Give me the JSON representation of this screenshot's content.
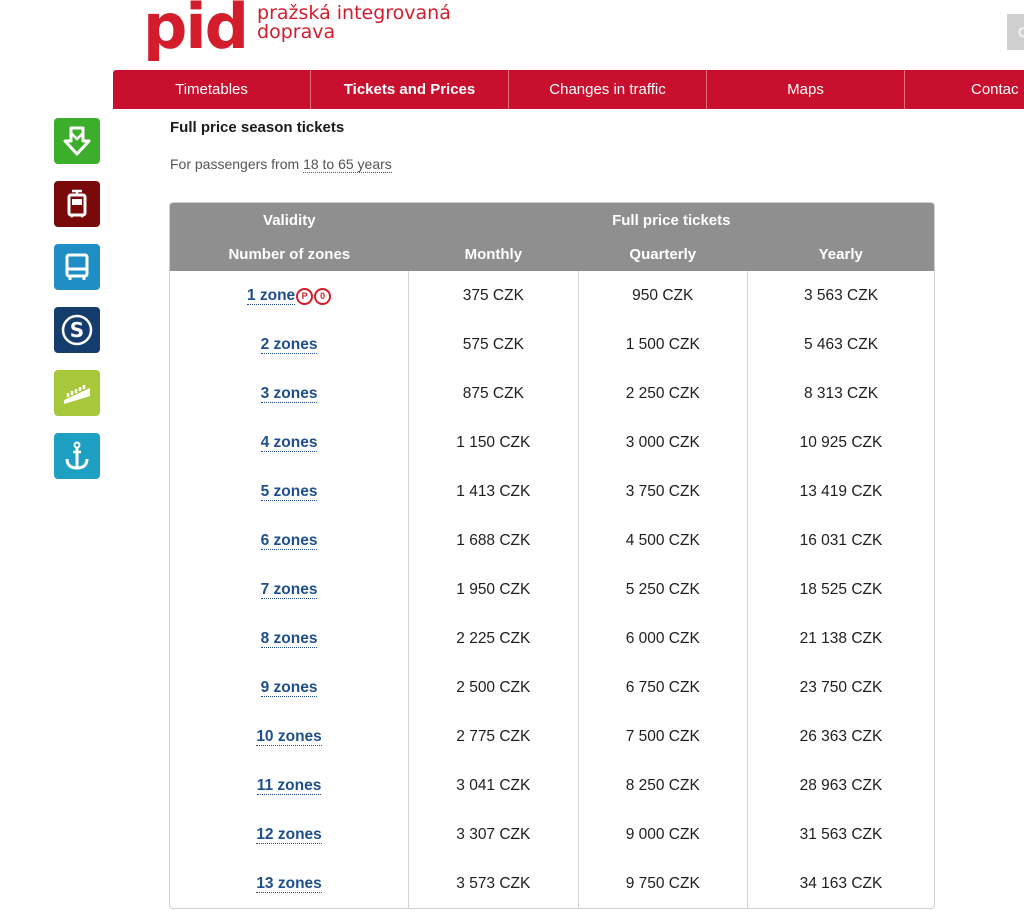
{
  "header": {
    "logo_mark": "pid",
    "logo_line1": "pražská integrovaná",
    "logo_line2": "doprava",
    "corner_text": "C"
  },
  "nav": {
    "items": [
      {
        "label": "Timetables",
        "active": false
      },
      {
        "label": "Tickets and Prices",
        "active": true
      },
      {
        "label": "Changes in traffic",
        "active": false
      },
      {
        "label": "Maps",
        "active": false
      },
      {
        "label": "Contac",
        "active": false
      }
    ]
  },
  "side_icons": [
    {
      "name": "metro-icon",
      "color": "#3dae2b"
    },
    {
      "name": "tram-icon",
      "color": "#7a0a0a"
    },
    {
      "name": "bus-icon",
      "color": "#1e8ec5"
    },
    {
      "name": "train-s-icon",
      "color": "#143d6e"
    },
    {
      "name": "funicular-icon",
      "color": "#a6c83a"
    },
    {
      "name": "ferry-icon",
      "color": "#1ea0c2"
    }
  ],
  "content": {
    "title": "Full price season tickets",
    "subtitle_prefix": "For passengers from ",
    "subtitle_age": "18 to 65 years"
  },
  "table": {
    "header_row1": {
      "validity": "Validity",
      "full_price": "Full price tickets"
    },
    "header_row2": {
      "zones": "Number of zones",
      "monthly": "Monthly",
      "quarterly": "Quarterly",
      "yearly": "Yearly"
    },
    "zone_badges": [
      "P",
      "0"
    ],
    "rows": [
      {
        "zones": "1 zone",
        "monthly": "375 CZK",
        "quarterly": "950 CZK",
        "yearly": "3 563 CZK"
      },
      {
        "zones": "2 zones",
        "monthly": "575 CZK",
        "quarterly": "1 500 CZK",
        "yearly": "5 463 CZK"
      },
      {
        "zones": "3 zones",
        "monthly": "875 CZK",
        "quarterly": "2 250 CZK",
        "yearly": "8 313 CZK"
      },
      {
        "zones": "4 zones",
        "monthly": "1 150 CZK",
        "quarterly": "3 000 CZK",
        "yearly": "10 925 CZK"
      },
      {
        "zones": "5 zones",
        "monthly": "1 413 CZK",
        "quarterly": "3 750 CZK",
        "yearly": "13 419 CZK"
      },
      {
        "zones": "6 zones",
        "monthly": "1 688 CZK",
        "quarterly": "4 500 CZK",
        "yearly": "16 031 CZK"
      },
      {
        "zones": "7 zones",
        "monthly": "1 950 CZK",
        "quarterly": "5 250 CZK",
        "yearly": "18 525 CZK"
      },
      {
        "zones": "8 zones",
        "monthly": "2 225 CZK",
        "quarterly": "6 000 CZK",
        "yearly": "21 138 CZK"
      },
      {
        "zones": "9 zones",
        "monthly": "2 500 CZK",
        "quarterly": "6 750 CZK",
        "yearly": "23 750 CZK"
      },
      {
        "zones": "10 zones",
        "monthly": "2 775 CZK",
        "quarterly": "7 500 CZK",
        "yearly": "26 363 CZK"
      },
      {
        "zones": "11 zones",
        "monthly": "3 041 CZK",
        "quarterly": "8 250 CZK",
        "yearly": "28 963 CZK"
      },
      {
        "zones": "12 zones",
        "monthly": "3 307 CZK",
        "quarterly": "9 000 CZK",
        "yearly": "31 563 CZK"
      },
      {
        "zones": "13 zones",
        "monthly": "3 573 CZK",
        "quarterly": "9 750 CZK",
        "yearly": "34 163 CZK"
      }
    ]
  }
}
